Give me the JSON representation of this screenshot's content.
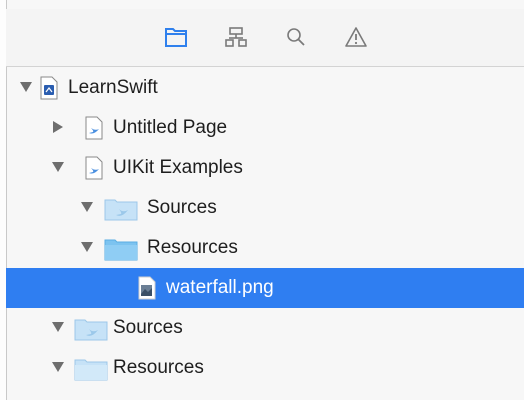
{
  "toolbar": {
    "buttons": [
      {
        "icon": "folder-navigator-icon",
        "active": true
      },
      {
        "icon": "symbol-navigator-icon",
        "active": false
      },
      {
        "icon": "search-navigator-icon",
        "active": false
      },
      {
        "icon": "issue-navigator-icon",
        "active": false
      }
    ],
    "accent_color": "#2f80ed"
  },
  "tree": [
    {
      "label": "LearnSwift",
      "icon": "playground-icon",
      "expanded": true,
      "depth": 0
    },
    {
      "label": "Untitled Page",
      "icon": "swift-file-icon",
      "expanded": false,
      "depth": 1
    },
    {
      "label": "UIKit Examples",
      "icon": "swift-file-icon",
      "expanded": true,
      "depth": 1
    },
    {
      "label": "Sources",
      "icon": "sources-folder-icon",
      "expanded": true,
      "depth": 2
    },
    {
      "label": "Resources",
      "icon": "folder-icon",
      "expanded": true,
      "depth": 2
    },
    {
      "label": "waterfall.png",
      "icon": "image-file-icon",
      "selected": true,
      "depth": 3
    },
    {
      "label": "Sources",
      "icon": "sources-folder-icon",
      "expanded": true,
      "depth": 1
    },
    {
      "label": "Resources",
      "icon": "folder-icon",
      "expanded": true,
      "depth": 1
    }
  ],
  "selection_color": "#2f7ef1"
}
